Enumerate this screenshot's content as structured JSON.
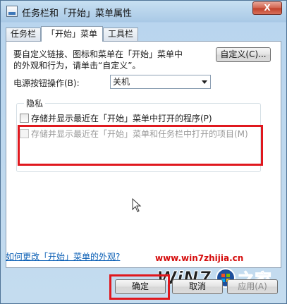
{
  "window": {
    "title": "任务栏和「开始」菜单属性",
    "close_label": "X"
  },
  "tabs": [
    {
      "label": "任务栏",
      "active": false
    },
    {
      "label": "「开始」菜单",
      "active": true
    },
    {
      "label": "工具栏",
      "active": false
    }
  ],
  "start_menu": {
    "description_line1": "要自定义链接、图标和菜单在「开始」菜单中",
    "description_line2": "的外观和行为，请单击“自定义”。",
    "customize_label": "自定义(C)...",
    "power_button_label": "电源按钮操作(B):",
    "power_button_value": "关机",
    "privacy_group_label": "隐私",
    "privacy_options": [
      {
        "label": "存储并显示最近在「开始」菜单中打开的程序(P)",
        "checked": false,
        "enabled": true
      },
      {
        "label": "存储并显示最近在「开始」菜单和任务栏中打开的项目(M)",
        "checked": false,
        "enabled": false
      }
    ],
    "help_link": "如何更改「开始」菜单的外观?"
  },
  "footer": {
    "ok_label": "确定",
    "cancel_label": "取消",
    "apply_label": "应用(A)"
  },
  "watermark": {
    "url": "www.win7zhijia.cn",
    "logo_text": "WiN7",
    "logo_suffix": "之家"
  },
  "colors": {
    "highlight_box": "#e0181e",
    "link": "#0b5fb5",
    "watermark_red": "#d50d0d",
    "frame": "#c4dcef"
  }
}
